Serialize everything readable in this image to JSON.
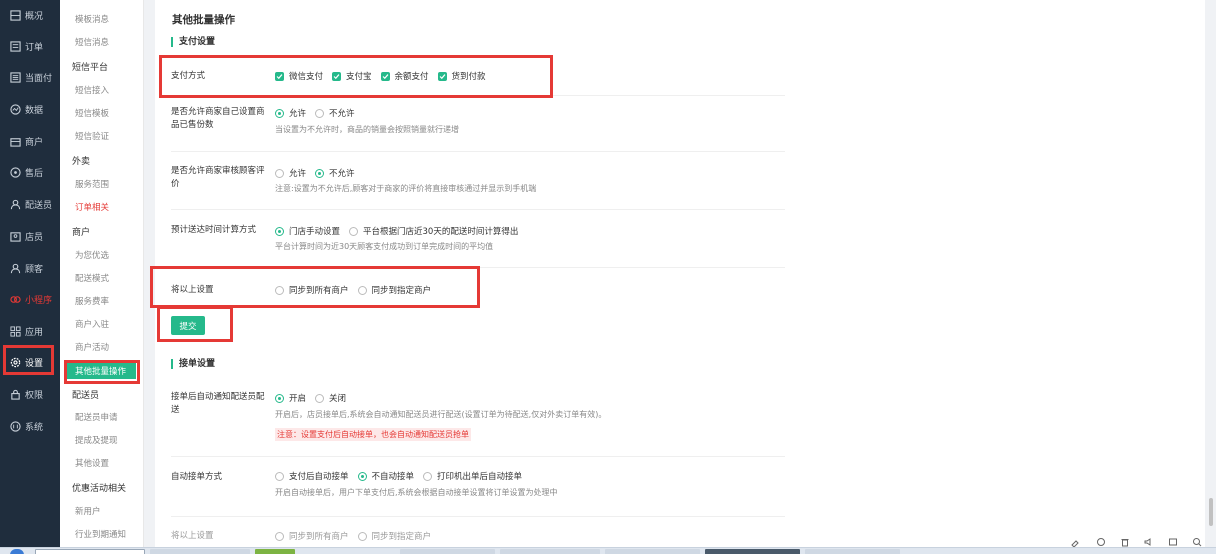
{
  "sidebar": {
    "items": [
      {
        "label": "概况",
        "icon": "overview-icon"
      },
      {
        "label": "订单",
        "icon": "order-icon"
      },
      {
        "label": "当面付",
        "icon": "face-pay-icon"
      },
      {
        "label": "数据",
        "icon": "data-icon"
      },
      {
        "label": "商户",
        "icon": "merchant-icon"
      },
      {
        "label": "售后",
        "icon": "after-sale-icon"
      },
      {
        "label": "配送员",
        "icon": "courier-icon"
      },
      {
        "label": "店员",
        "icon": "clerk-icon"
      },
      {
        "label": "顾客",
        "icon": "customer-icon"
      },
      {
        "label": "小程序",
        "icon": "miniprogram-icon"
      },
      {
        "label": "应用",
        "icon": "apps-icon"
      },
      {
        "label": "设置",
        "icon": "gear-icon"
      },
      {
        "label": "权限",
        "icon": "lock-icon"
      },
      {
        "label": "系统",
        "icon": "system-icon"
      }
    ]
  },
  "subnav": {
    "items": [
      {
        "label": "模板消息"
      },
      {
        "label": "短信消息"
      },
      {
        "label": "短信平台"
      },
      {
        "label": "短信接入"
      },
      {
        "label": "短信模板"
      },
      {
        "label": "短信验证"
      },
      {
        "label": "外卖"
      },
      {
        "label": "服务范围"
      },
      {
        "label": "订单相关"
      },
      {
        "label": "商户"
      },
      {
        "label": "为您优选"
      },
      {
        "label": "配送模式"
      },
      {
        "label": "服务费率"
      },
      {
        "label": "商户入驻"
      },
      {
        "label": "商户活动"
      },
      {
        "label": "其他批量操作"
      },
      {
        "label": "配送员"
      },
      {
        "label": "配送员申请"
      },
      {
        "label": "提成及提现"
      },
      {
        "label": "其他设置"
      },
      {
        "label": "优惠活动相关"
      },
      {
        "label": "新用户"
      },
      {
        "label": "行业到期通知"
      }
    ]
  },
  "page": {
    "title": "其他批量操作",
    "submit_label": "提交"
  },
  "payment_section": {
    "title": "支付设置",
    "pay_method": {
      "label": "支付方式",
      "options": [
        "微信支付",
        "支付宝",
        "余额支付",
        "货到付款"
      ],
      "checked": [
        true,
        true,
        true,
        true
      ]
    },
    "sales_count": {
      "label": "是否允许商家自己设置商品已售份数",
      "options": [
        "允许",
        "不允许"
      ],
      "selected": "允许",
      "hint": "当设置为不允许时，商品的销量会按照销量就行递增"
    },
    "review": {
      "label": "是否允许商家审核顾客评价",
      "options": [
        "允许",
        "不允许"
      ],
      "selected": "不允许",
      "hint": "注意:设置为不允许后,顾客对于商家的评价将直接审核通过并显示到手机端"
    },
    "delivery_time": {
      "label": "预计送达时间计算方式",
      "options": [
        "门店手动设置",
        "平台根据门店近30天的配送时间计算得出"
      ],
      "selected": "门店手动设置",
      "hint": "平台计算时间为近30天顾客支付成功到订单完成时间的平均值"
    },
    "sync": {
      "label": "将以上设置",
      "options": [
        "同步到所有商户",
        "同步到指定商户"
      ]
    }
  },
  "order_section": {
    "title": "接单设置",
    "notify_courier": {
      "label": "接单后自动通知配送员配送",
      "options": [
        "开启",
        "关闭"
      ],
      "selected": "开启",
      "hint": "开启后，店员接单后,系统会自动通知配送员进行配送(设置订单为待配送,仅对外卖订单有效)。",
      "warning": "注意：设置支付后自动接单，也会自动通知配送员抢单"
    },
    "auto_accept": {
      "label": "自动接单方式",
      "options": [
        "支付后自动接单",
        "不自动接单",
        "打印机出单后自动接单"
      ],
      "selected": "不自动接单",
      "hint": "开启自动接单后，用户下单支付后,系统会根据自动接单设置将订单设置为处理中"
    }
  },
  "colors": {
    "accent": "#25b98b",
    "highlight": "#e53935",
    "sidebar_bg": "#1f2d3d"
  }
}
